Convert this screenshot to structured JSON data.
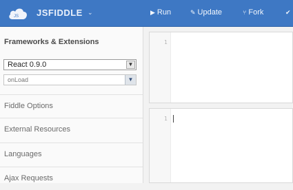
{
  "header": {
    "logo_text": "JSFIDDLE",
    "logo_chevron": "⌄",
    "actions": [
      {
        "label": "Run",
        "icon": "play-icon",
        "glyph": "▶"
      },
      {
        "label": "Update",
        "icon": "pencil-icon",
        "glyph": "✎"
      },
      {
        "label": "Fork",
        "icon": "fork-icon",
        "glyph": "⑂"
      },
      {
        "label": "",
        "icon": "check-icon",
        "glyph": "✔"
      }
    ],
    "colors": {
      "bar": "#3e78c4",
      "text": "#ffffff"
    }
  },
  "sidebar": {
    "title": "Frameworks & Extensions",
    "framework_select": {
      "value": "React 0.9.0"
    },
    "load_select": {
      "value": "onLoad"
    },
    "sections": [
      {
        "label": "Fiddle Options"
      },
      {
        "label": "External Resources"
      },
      {
        "label": "Languages"
      },
      {
        "label": "Ajax Requests"
      }
    ]
  },
  "editors": [
    {
      "line_number": "1"
    },
    {
      "line_number": "1"
    }
  ]
}
